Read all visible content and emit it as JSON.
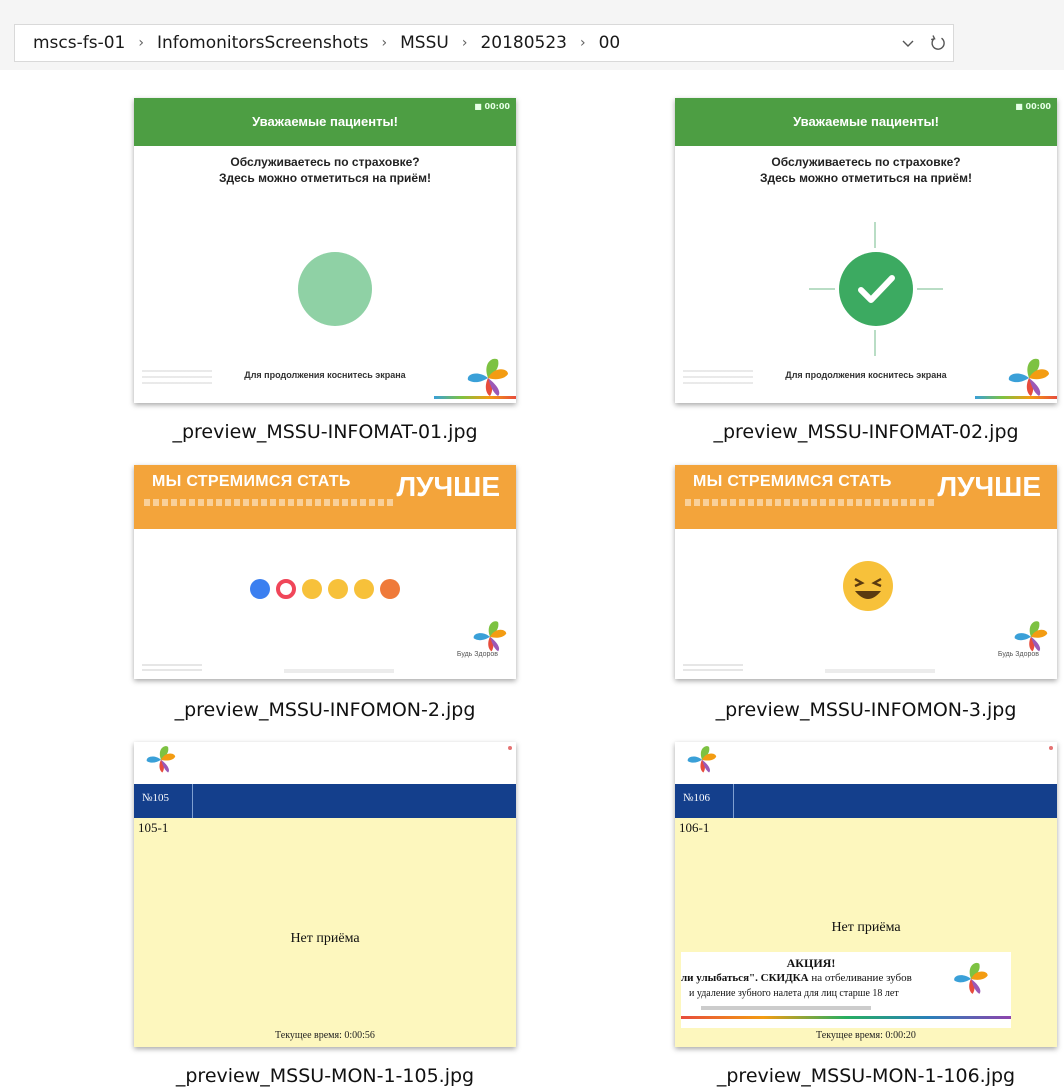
{
  "breadcrumb": [
    "mscs-fs-01",
    "InfomonitorsScreenshots",
    "MSSU",
    "20180523",
    "00"
  ],
  "files": [
    {
      "name": "_preview_MSSU-INFOMAT-01.jpg",
      "kind": "infomat",
      "variant": "circle",
      "header": "Уважаемые пациенты!",
      "clock": "■ 00:00",
      "line1": "Обслуживаетесь по страховке?",
      "line2": "Здесь можно отметиться на приём!",
      "footer": "Для продолжения коснитесь экрана"
    },
    {
      "name": "_preview_MSSU-INFOMAT-02.jpg",
      "kind": "infomat",
      "variant": "check",
      "header": "Уважаемые пациенты!",
      "clock": "■ 00:00",
      "line1": "Обслуживаетесь по страховке?",
      "line2": "Здесь можно отметиться на приём!",
      "footer": "Для продолжения коснитесь экрана",
      "check": "✓"
    },
    {
      "name": "_preview_MSSU-INFOMON-2.jpg",
      "kind": "infomon",
      "variant": "row",
      "slogan": "МЫ СТРЕМИМСЯ СТАТЬ",
      "slogan_big": "ЛУЧШЕ",
      "mark": "Будь Здоров"
    },
    {
      "name": "_preview_MSSU-INFOMON-3.jpg",
      "kind": "infomon",
      "variant": "big",
      "slogan": "МЫ СТРЕМИМСЯ СТАТЬ",
      "slogan_big": "ЛУЧШЕ",
      "mark": "Будь Здоров"
    },
    {
      "name": "_preview_MSSU-MON-1-105.jpg",
      "kind": "mon",
      "room": "№105",
      "sub": "105-1",
      "none": "Нет приёма",
      "time": "Текущее время: 0:00:56"
    },
    {
      "name": "_preview_MSSU-MON-1-106.jpg",
      "kind": "mon",
      "room": "№106",
      "sub": "106-1",
      "none": "Нет приёма",
      "time": "Текущее время: 0:00:20",
      "promo": {
        "title": "АКЦИЯ!",
        "l1a": "ли улыбаться\". ",
        "l1b": "СКИДКА",
        "l1c": " на отбеливание зубов",
        "l2": "и удаление зубного налета для лиц старше 18 лет"
      }
    }
  ],
  "icons": {
    "dropdown": "chevron-down-icon",
    "refresh": "refresh-icon"
  },
  "colors": {
    "green": "#4d9e43",
    "orange": "#f3a43b",
    "navy": "#143f8c",
    "cream": "#fdf7be"
  }
}
